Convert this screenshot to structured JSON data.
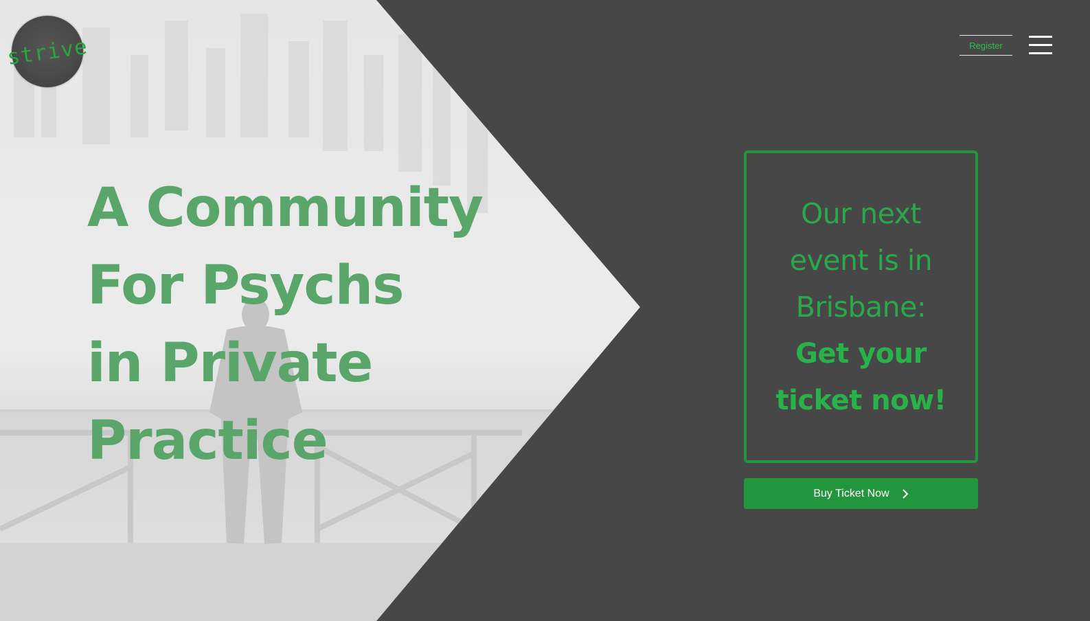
{
  "brand": {
    "logo_text": "strive"
  },
  "nav": {
    "register_label": "Register",
    "menu_icon": "hamburger-menu-icon"
  },
  "hero": {
    "headline_lines": [
      "A Community",
      "For Psychs",
      "in Private",
      "Practice"
    ]
  },
  "event": {
    "lines": [
      "Our next",
      "event is in",
      "Brisbane:"
    ],
    "cta_lines": [
      "Get your",
      "ticket now!"
    ],
    "button_label": "Buy Ticket Now",
    "button_icon": "chevron-right-icon"
  },
  "colors": {
    "background": "#474747",
    "accent_green": "#22953d",
    "headline_green": "#5aa56a",
    "event_text_green": "#2aa84a"
  }
}
